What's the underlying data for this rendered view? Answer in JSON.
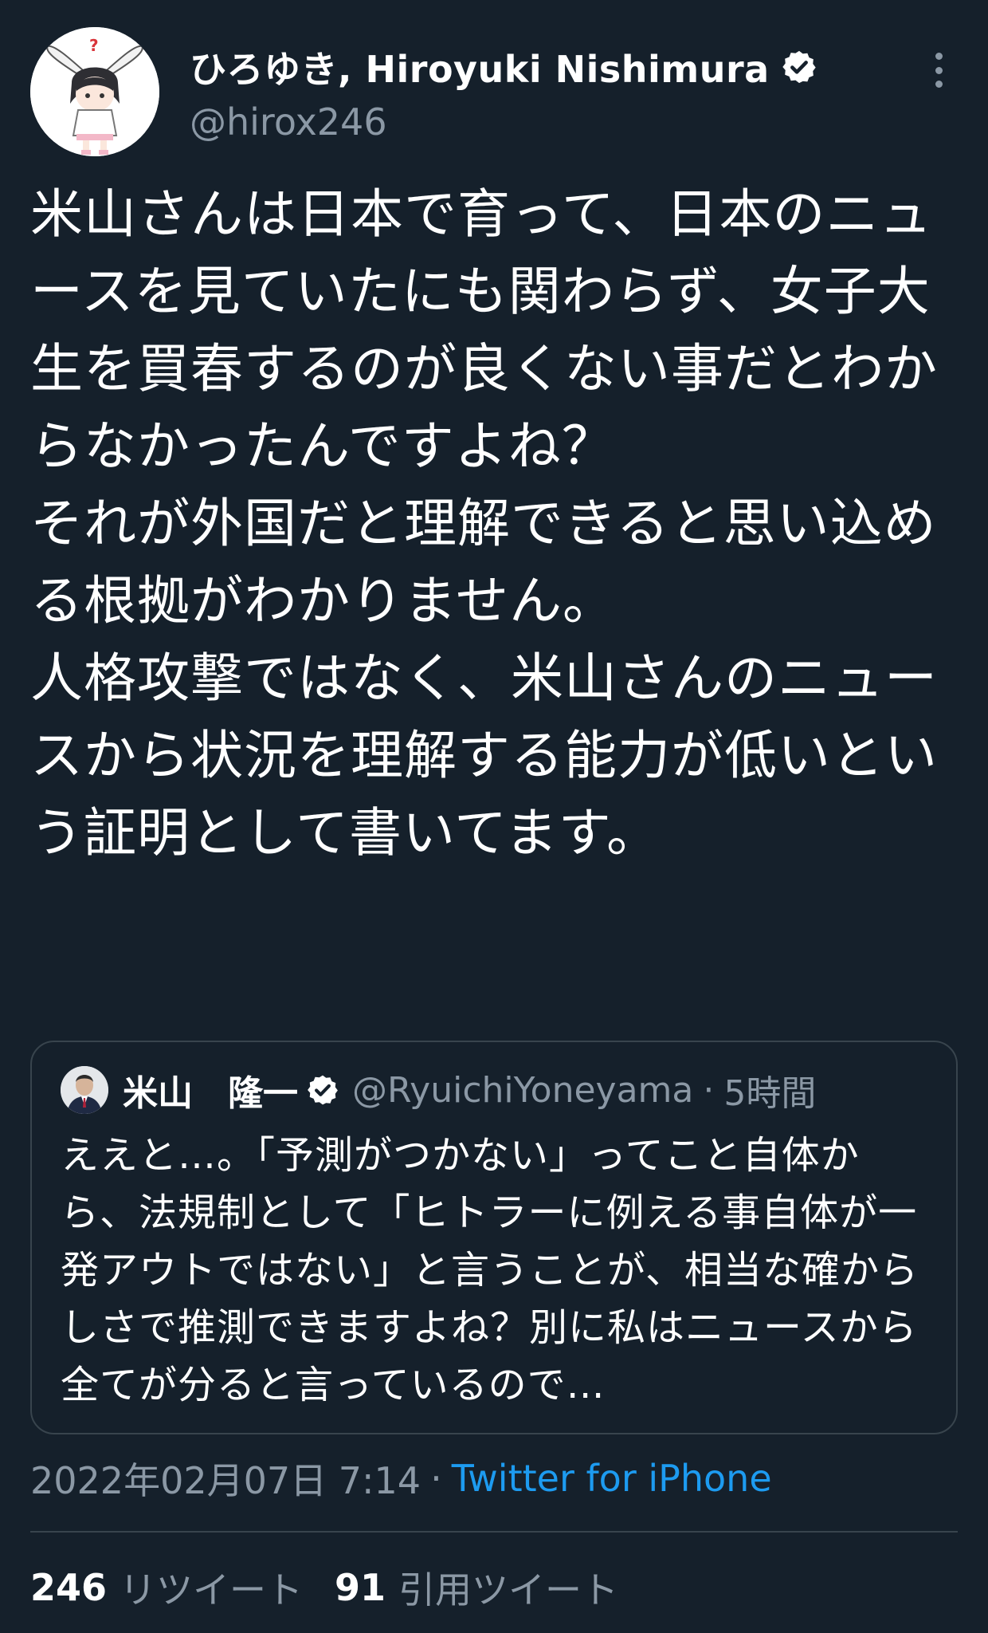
{
  "author": {
    "name": "ひろゆき, Hiroyuki Nishimura",
    "handle": "@hirox246",
    "verified": true
  },
  "tweet": {
    "text": "米山さんは日本で育って、日本のニュースを見ていたにも関わらず、女子大生を買春するのが良くない事だとわからなかったんですよね？\nそれが外国だと理解できると思い込める根拠がわかりません。\n人格攻撃ではなく、米山さんのニュースから状況を理解する能力が低いという証明として書いてます。"
  },
  "quote": {
    "name": "米山　隆一",
    "handle": "@RyuichiYoneyama",
    "separator": "·",
    "time": "5時間",
    "text": "ええと…。「予測がつかない」ってこと自体から、法規制として「ヒトラーに例える事自体が一発アウトではない」と言うことが、相当な確からしさで推測できますよね？別に私はニュースから全てが分ると言っているので…"
  },
  "meta": {
    "date": "2022年02月07日 7:14",
    "separator": "·",
    "source": "Twitter for iPhone"
  },
  "stats": {
    "retweets": "246",
    "retweets_label": "リツイート",
    "quotes": "91",
    "quotes_label": "引用ツイート"
  },
  "colors": {
    "background": "#15202b",
    "text_primary": "#ffffff",
    "text_secondary": "#8b98a5",
    "link": "#1d9bf0",
    "border": "#38444d"
  },
  "icons": {
    "verified": "verified-badge-icon",
    "more": "more-options-icon"
  }
}
